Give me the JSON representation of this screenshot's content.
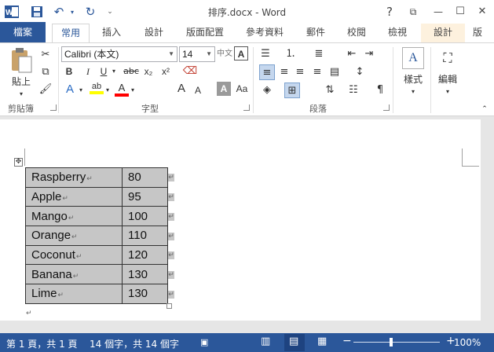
{
  "window": {
    "title": "排序.docx - Word",
    "controls": {
      "help": "?",
      "ribbon_display": "⧉",
      "minimize": "—",
      "maximize": "☐",
      "close": "✕"
    }
  },
  "quick_access": {
    "app_icon": "word-icon",
    "save": "save-icon",
    "undo": "undo-icon",
    "redo": "redo-icon",
    "customize": "customize-qat-icon"
  },
  "tabs": [
    "檔案",
    "常用",
    "插入",
    "設計",
    "版面配置",
    "參考資料",
    "郵件",
    "校閱",
    "檢視",
    "設計",
    "版"
  ],
  "active_tab": "常用",
  "ribbon": {
    "clipboard": {
      "label": "剪貼簿",
      "paste": "貼上"
    },
    "font": {
      "label": "字型",
      "font_name": "Calibri (本文)",
      "font_size": "14",
      "bold": "B",
      "italic": "I",
      "underline": "U",
      "strike": "abc",
      "subscript": "x₂",
      "superscript": "x²",
      "grow": "A",
      "shrink": "A",
      "case": "Aa",
      "phonetic": "中文",
      "char_border": "A",
      "highlight_color": "#ffff00",
      "font_color": "#ff0000"
    },
    "paragraph": {
      "label": "段落"
    },
    "styles": {
      "label": "樣式"
    },
    "editing": {
      "label": "編輯"
    }
  },
  "document": {
    "table": [
      {
        "fruit": "Raspberry",
        "value": "80"
      },
      {
        "fruit": "Apple",
        "value": "95"
      },
      {
        "fruit": "Mango",
        "value": "100"
      },
      {
        "fruit": "Orange",
        "value": "110"
      },
      {
        "fruit": "Coconut",
        "value": "120"
      },
      {
        "fruit": "Banana",
        "value": "130"
      },
      {
        "fruit": "Lime",
        "value": "130"
      }
    ],
    "paragraph_mark": "↵",
    "cell_fill": "#c6c6c6"
  },
  "statusbar": {
    "page": "第 1 頁，共 1 頁",
    "words": "14 個字，共 14 個字",
    "zoom": "100%",
    "zoom_level": 1.0,
    "zoom_out": "−",
    "zoom_in": "+"
  },
  "colors": {
    "accent": "#2b579a",
    "context_tab": "#fdf1de"
  }
}
